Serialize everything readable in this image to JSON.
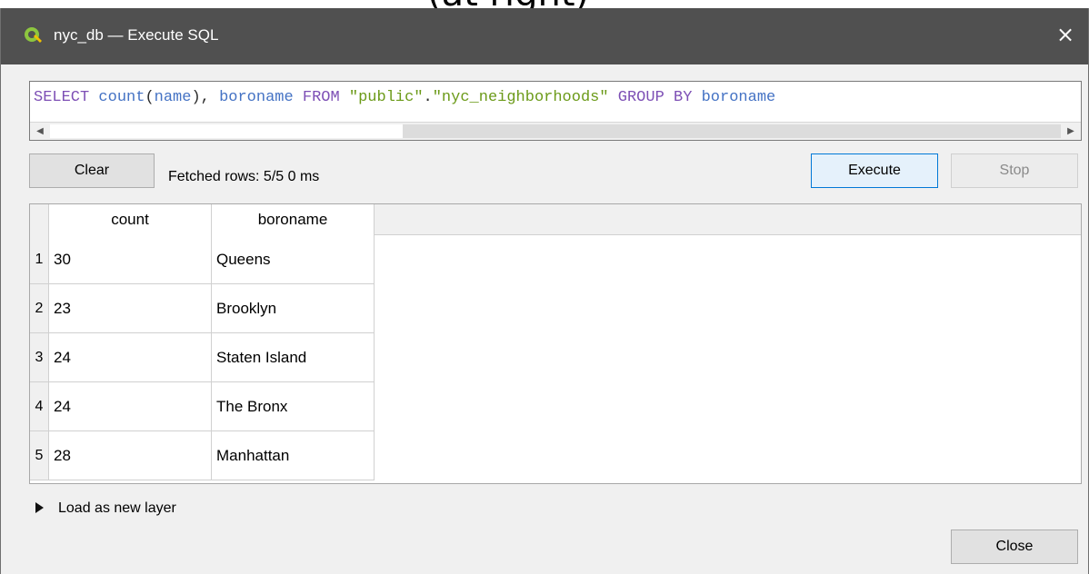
{
  "window": {
    "title": "nyc_db — Execute SQL",
    "close_glyph": "×",
    "top_clipped_text": "(at right)"
  },
  "icons": {
    "app_logo": "qgis-logo-icon",
    "close": "close-icon",
    "scroll_left": "scroll-left-arrow-icon",
    "scroll_right": "scroll-right-arrow-icon",
    "expand": "expand-triangle-icon"
  },
  "sql": {
    "tokens": [
      {
        "t": "SELECT",
        "c": "kw"
      },
      {
        "t": " ",
        "c": ""
      },
      {
        "t": "count",
        "c": "id"
      },
      {
        "t": "(",
        "c": ""
      },
      {
        "t": "name",
        "c": "id"
      },
      {
        "t": "), ",
        "c": ""
      },
      {
        "t": "boroname",
        "c": "id"
      },
      {
        "t": " ",
        "c": ""
      },
      {
        "t": "FROM",
        "c": "kw"
      },
      {
        "t": " ",
        "c": ""
      },
      {
        "t": "\"public\"",
        "c": "str"
      },
      {
        "t": ".",
        "c": ""
      },
      {
        "t": "\"nyc_neighborhoods\"",
        "c": "str"
      },
      {
        "t": " ",
        "c": ""
      },
      {
        "t": "GROUP BY",
        "c": "kw"
      },
      {
        "t": " ",
        "c": ""
      },
      {
        "t": "boroname",
        "c": "id"
      }
    ]
  },
  "toolbar": {
    "clear_label": "Clear",
    "status": "Fetched rows: 5/5  0 ms",
    "execute_label": "Execute",
    "stop_label": "Stop"
  },
  "results": {
    "columns": [
      "count",
      "boroname"
    ],
    "rows": [
      {
        "n": "1",
        "count": "30",
        "boroname": "Queens"
      },
      {
        "n": "2",
        "count": "23",
        "boroname": "Brooklyn"
      },
      {
        "n": "3",
        "count": "24",
        "boroname": "Staten Island"
      },
      {
        "n": "4",
        "count": "24",
        "boroname": "The Bronx"
      },
      {
        "n": "5",
        "count": "28",
        "boroname": "Manhattan"
      }
    ]
  },
  "footer": {
    "load_layer_label": "Load as new layer",
    "close_label": "Close"
  },
  "colors": {
    "titlebar": "#505050",
    "keyword": "#7d4fb5",
    "identifier": "#4472c4",
    "string": "#6b9a18"
  }
}
